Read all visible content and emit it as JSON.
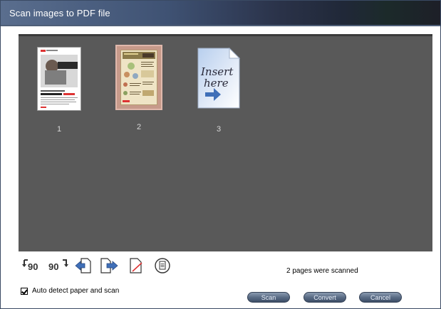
{
  "window": {
    "title": "Scan images to PDF file"
  },
  "pages": [
    {
      "number": "1",
      "selected": false
    },
    {
      "number": "2",
      "selected": true
    },
    {
      "number": "3",
      "placeholder_text": "Insert here"
    }
  ],
  "toolbar": {
    "rotate_left_label": "90",
    "rotate_right_label": "90",
    "icons": [
      "rotate-left-icon",
      "rotate-right-icon",
      "move-page-left-icon",
      "move-page-right-icon",
      "delete-page-icon",
      "zoom-page-icon"
    ]
  },
  "status": {
    "text": "2 pages were scanned"
  },
  "options": {
    "auto_detect_label": "Auto detect paper and scan",
    "auto_detect_checked": true
  },
  "buttons": {
    "scan": "Scan",
    "convert": "Convert",
    "cancel": "Cancel"
  },
  "colors": {
    "scan_area": "#595959",
    "selected_border": "#c79a8a",
    "button": "#5b6d86"
  }
}
